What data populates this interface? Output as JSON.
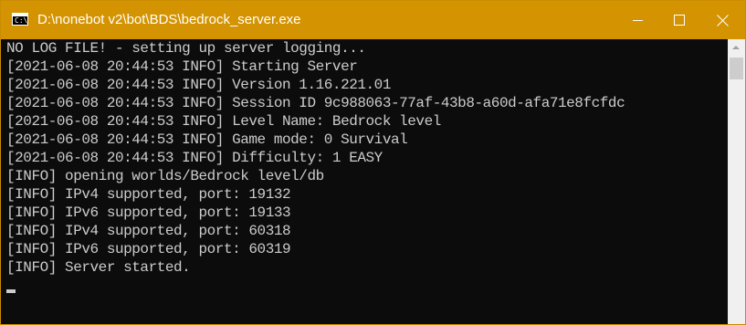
{
  "window": {
    "title": "D:\\nonebot v2\\bot\\BDS\\bedrock_server.exe",
    "icon_prompt": "C:\\",
    "controls": {
      "minimize": "minimize-icon",
      "maximize": "maximize-icon",
      "close": "close-icon"
    },
    "titlebar_color": "#d49300"
  },
  "console": {
    "background": "#0c0c0c",
    "text_color": "#cccccc",
    "lines": [
      "NO LOG FILE! - setting up server logging...",
      "[2021-06-08 20:44:53 INFO] Starting Server",
      "[2021-06-08 20:44:53 INFO] Version 1.16.221.01",
      "[2021-06-08 20:44:53 INFO] Session ID 9c988063-77af-43b8-a60d-afa71e8fcfdc",
      "[2021-06-08 20:44:53 INFO] Level Name: Bedrock level",
      "[2021-06-08 20:44:53 INFO] Game mode: 0 Survival",
      "[2021-06-08 20:44:53 INFO] Difficulty: 1 EASY",
      "[INFO] opening worlds/Bedrock level/db",
      "[INFO] IPv4 supported, port: 19132",
      "[INFO] IPv6 supported, port: 19133",
      "[INFO] IPv4 supported, port: 60318",
      "[INFO] IPv6 supported, port: 60319",
      "[INFO] Server started."
    ]
  }
}
